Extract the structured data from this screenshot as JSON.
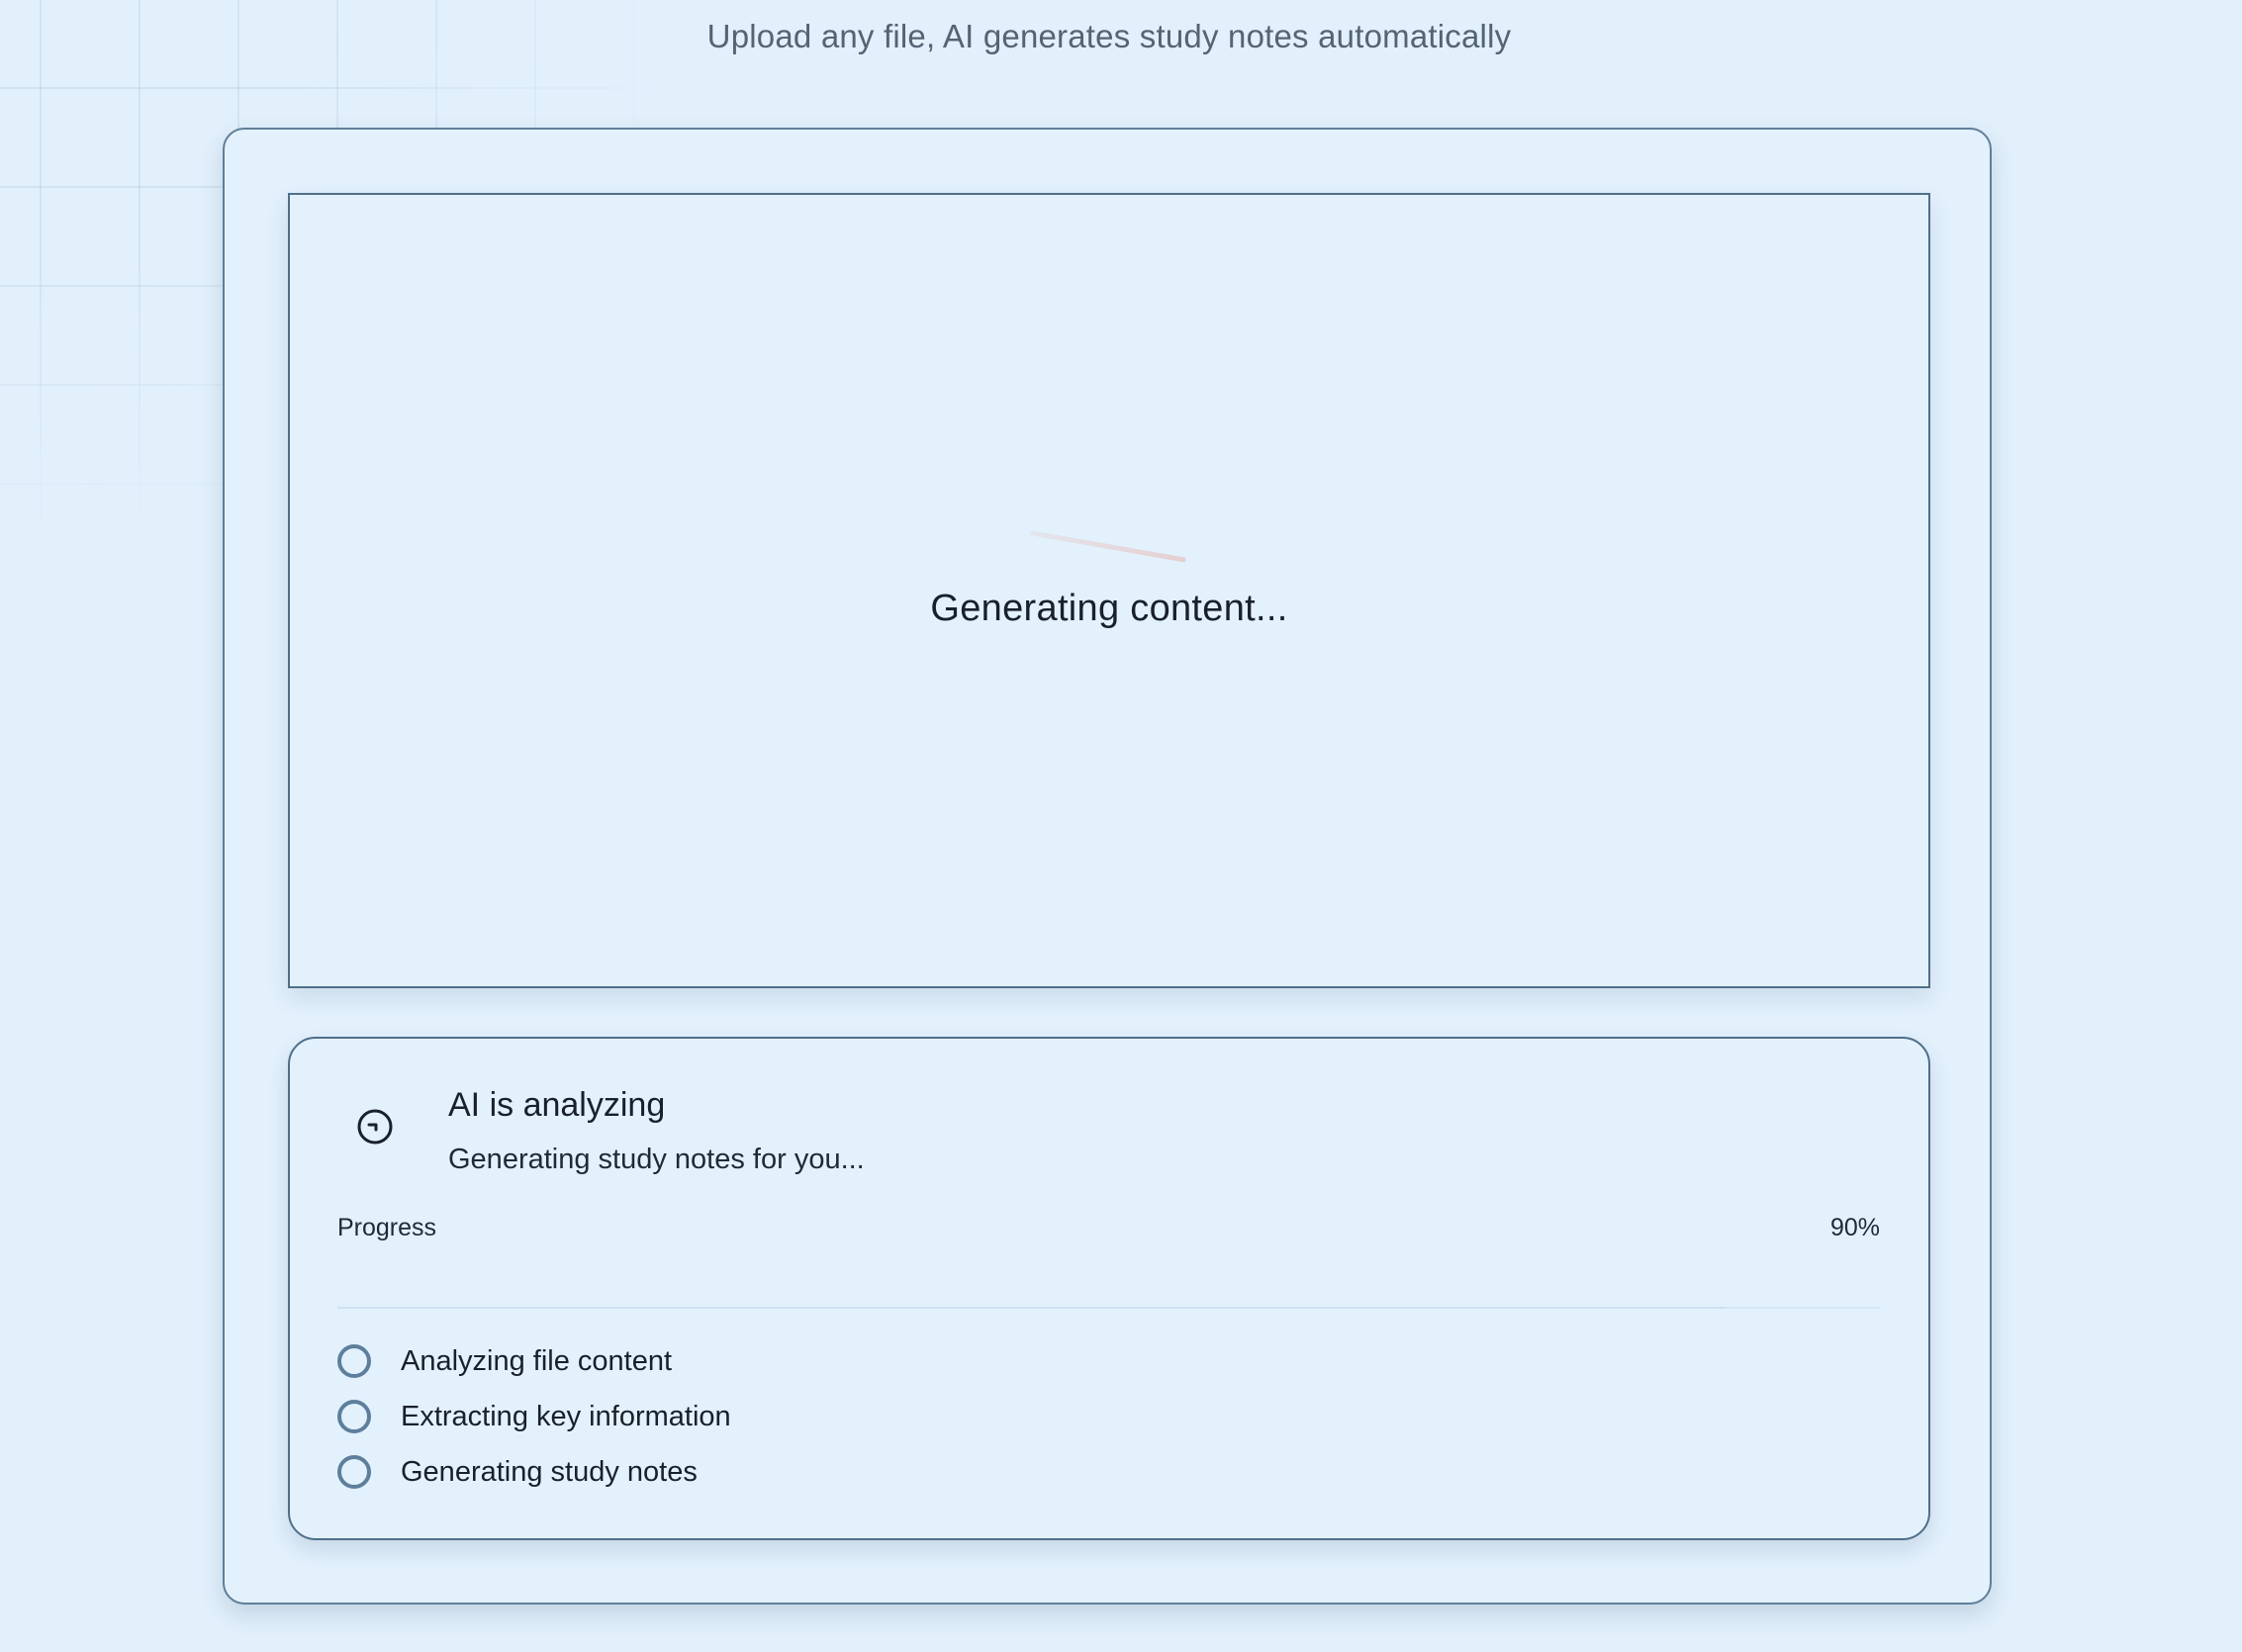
{
  "header": {
    "subtitle": "Upload any file, AI generates study notes automatically"
  },
  "preview": {
    "status_text": "Generating content..."
  },
  "status_card": {
    "icon": "spinner-icon",
    "title": "AI is analyzing",
    "subtitle": "Generating study notes for you...",
    "progress_label": "Progress",
    "progress_text": "90%",
    "progress_value": 0.9
  },
  "steps": [
    {
      "label": "Analyzing file content"
    },
    {
      "label": "Extracting key information"
    },
    {
      "label": "Generating study notes"
    }
  ],
  "colors": {
    "background": "#e2f0fc",
    "border": "#4f6f88",
    "step_circle": "#5e7f9c",
    "text": "#18212b"
  }
}
